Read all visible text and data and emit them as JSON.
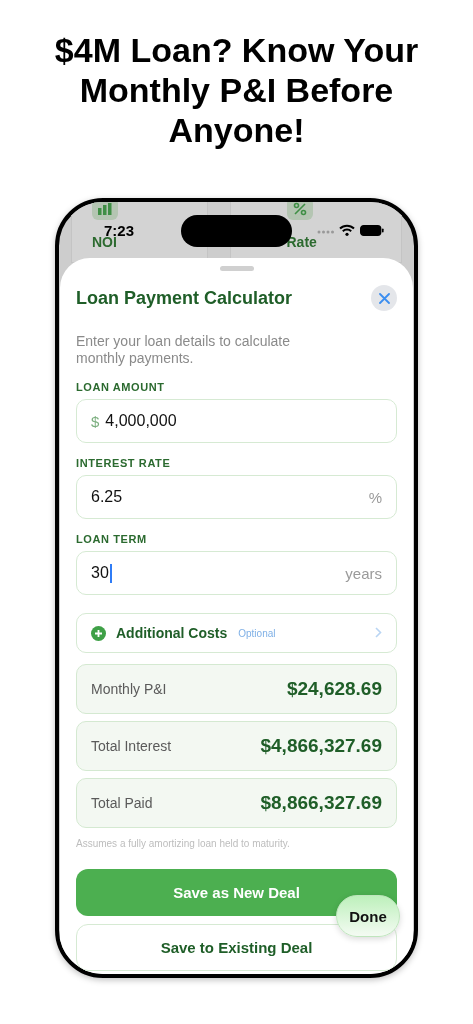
{
  "headline": "$4M Loan? Know Your Monthly P&I Before Anyone!",
  "status_bar": {
    "time": "7:23"
  },
  "background_cards": [
    {
      "title": "NOI"
    },
    {
      "title": "Rate"
    }
  ],
  "sheet": {
    "title": "Loan Payment Calculator",
    "description": "Enter your loan details to calculate monthly payments."
  },
  "fields": [
    {
      "label": "LOAN AMOUNT",
      "prefix": "$",
      "value": "4,000,000",
      "focused": false
    },
    {
      "label": "INTEREST RATE",
      "value": "6.25",
      "suffix": "%",
      "focused": false
    },
    {
      "label": "LOAN TERM",
      "value": "30",
      "suffix": "years",
      "focused": true
    }
  ],
  "additional_costs": {
    "label": "Additional Costs",
    "hint": "Optional"
  },
  "results": [
    {
      "label": "Monthly P&I",
      "value": "$24,628.69"
    },
    {
      "label": "Total Interest",
      "value": "$4,866,327.69"
    },
    {
      "label": "Total Paid",
      "value": "$8,866,327.69"
    }
  ],
  "footnote": "Assumes a fully amortizing loan held to maturity.",
  "buttons": [
    {
      "label": "Save as New Deal",
      "kind": "primary"
    },
    {
      "label": "Save to Existing Deal",
      "kind": "secondary"
    }
  ],
  "keyboard_done": "Done"
}
